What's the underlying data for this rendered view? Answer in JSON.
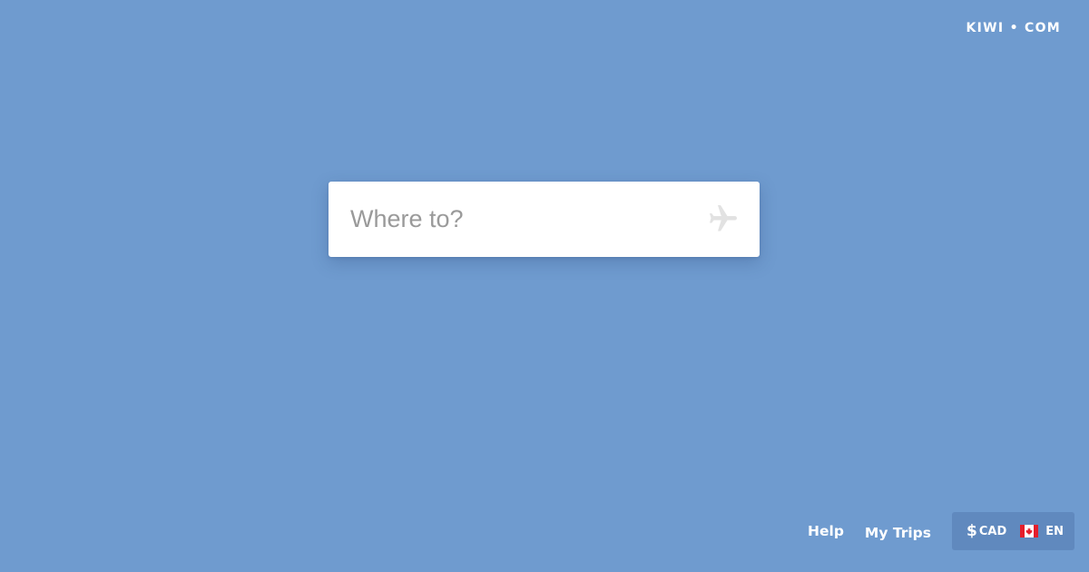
{
  "brand": {
    "logo_text": "KIWI • COM"
  },
  "search": {
    "placeholder": "Where to?",
    "value": "",
    "icon": "airplane-icon"
  },
  "footer": {
    "links": [
      {
        "label": "Help"
      },
      {
        "label": "My Trips"
      }
    ],
    "locale": {
      "currency_symbol": "$",
      "currency_code": "CAD",
      "flag_icon": "canada-flag-icon",
      "language": "EN"
    }
  },
  "colors": {
    "background": "#6f9bcf",
    "locale_button": "#6089be",
    "search_background": "#ffffff",
    "placeholder": "#9a9a9a",
    "icon": "#e2e2e2",
    "flag_red": "#e41e2b"
  }
}
